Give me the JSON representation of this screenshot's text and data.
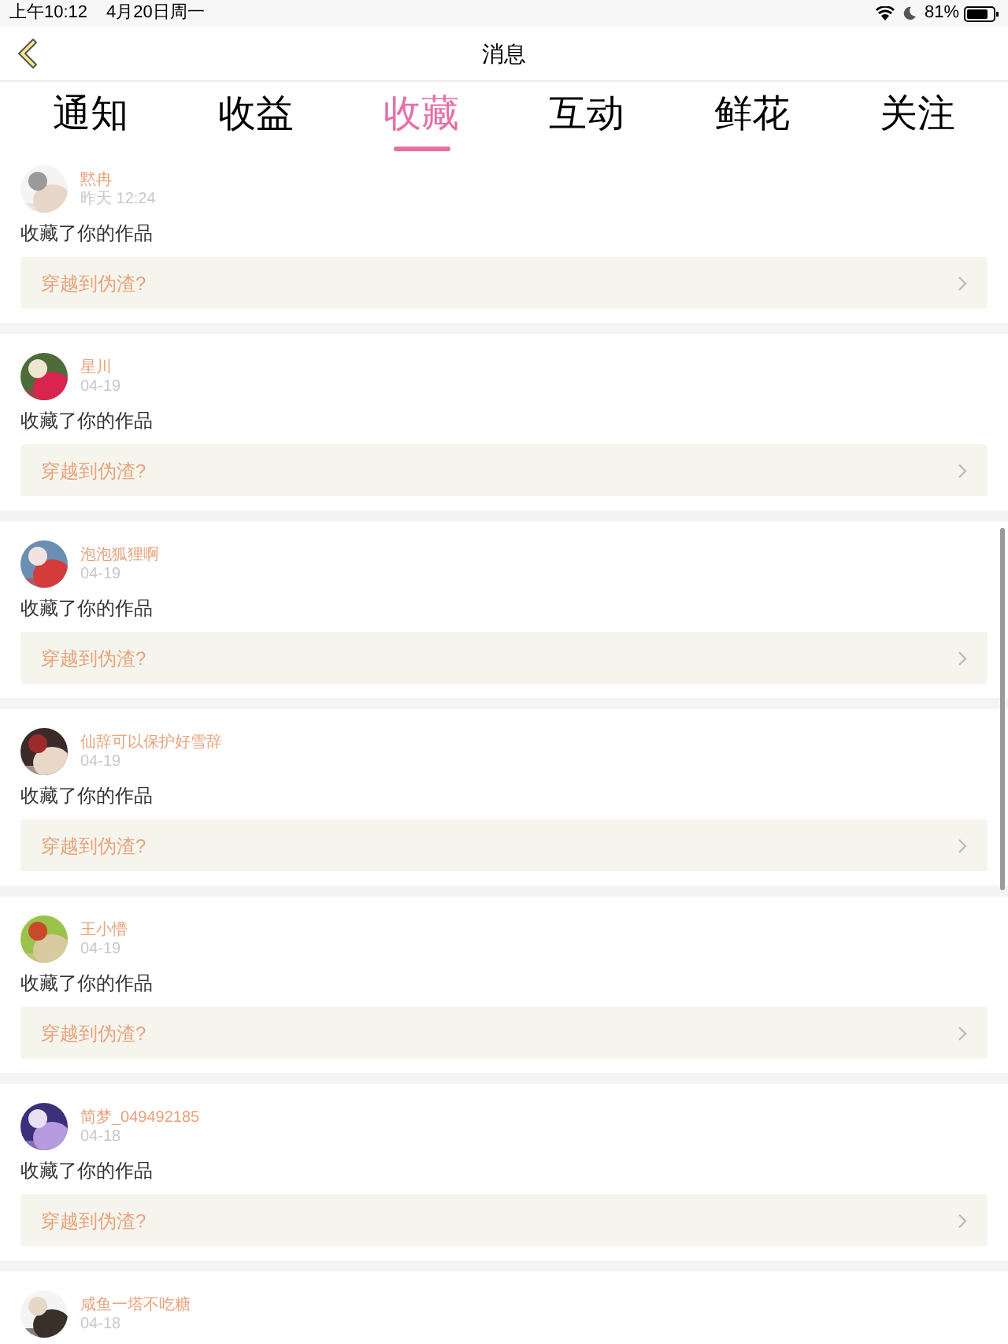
{
  "status_bar": {
    "time": "上午10:12",
    "date": "4月20日周一",
    "battery": "81%"
  },
  "nav": {
    "title": "消息"
  },
  "tabs": [
    {
      "label": "通知",
      "selected": false
    },
    {
      "label": "收益",
      "selected": false
    },
    {
      "label": "收藏",
      "selected": true
    },
    {
      "label": "互动",
      "selected": false
    },
    {
      "label": "鲜花",
      "selected": false
    },
    {
      "label": "关注",
      "selected": false
    }
  ],
  "items": [
    {
      "name": "黙冉",
      "time": "昨天 12:24",
      "action": "收藏了你的作品",
      "work": "穿越到伪渣?"
    },
    {
      "name": "星川",
      "time": "04-19",
      "action": "收藏了你的作品",
      "work": "穿越到伪渣?"
    },
    {
      "name": "泡泡狐狸啊",
      "time": "04-19",
      "action": "收藏了你的作品",
      "work": "穿越到伪渣?"
    },
    {
      "name": "仙辞可以保护好雪辞",
      "time": "04-19",
      "action": "收藏了你的作品",
      "work": "穿越到伪渣?"
    },
    {
      "name": "王小懵",
      "time": "04-19",
      "action": "收藏了你的作品",
      "work": "穿越到伪渣?"
    },
    {
      "name": "简梦_049492185",
      "time": "04-18",
      "action": "收藏了你的作品",
      "work": "穿越到伪渣?"
    },
    {
      "name": "咸鱼一塔不吃糖",
      "time": "04-18"
    }
  ]
}
